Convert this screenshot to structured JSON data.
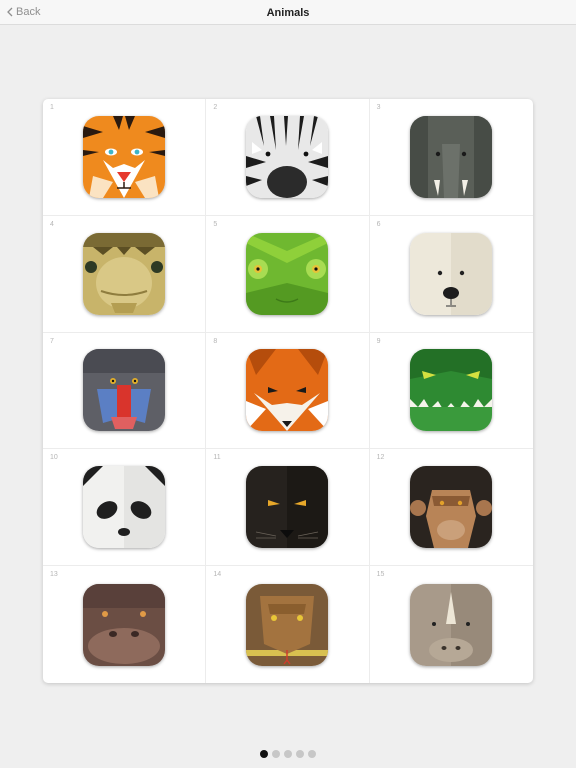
{
  "nav": {
    "back_label": "Back",
    "title": "Animals"
  },
  "animals": [
    {
      "number": "1",
      "icon": "tiger-icon"
    },
    {
      "number": "2",
      "icon": "zebra-icon"
    },
    {
      "number": "3",
      "icon": "elephant-icon"
    },
    {
      "number": "4",
      "icon": "turtle-icon"
    },
    {
      "number": "5",
      "icon": "chameleon-icon"
    },
    {
      "number": "6",
      "icon": "polar-bear-icon"
    },
    {
      "number": "7",
      "icon": "mandrill-icon"
    },
    {
      "number": "8",
      "icon": "fox-icon"
    },
    {
      "number": "9",
      "icon": "crocodile-icon"
    },
    {
      "number": "10",
      "icon": "panda-icon"
    },
    {
      "number": "11",
      "icon": "panther-icon"
    },
    {
      "number": "12",
      "icon": "chimpanzee-icon"
    },
    {
      "number": "13",
      "icon": "hippo-icon"
    },
    {
      "number": "14",
      "icon": "snake-icon"
    },
    {
      "number": "15",
      "icon": "rhino-icon"
    }
  ],
  "pager": {
    "pages": 5,
    "current": 1
  },
  "colors": {
    "background": "#efefef",
    "card": "#ffffff",
    "active_dot": "#111111",
    "inactive_dot": "#c7c7c7"
  }
}
